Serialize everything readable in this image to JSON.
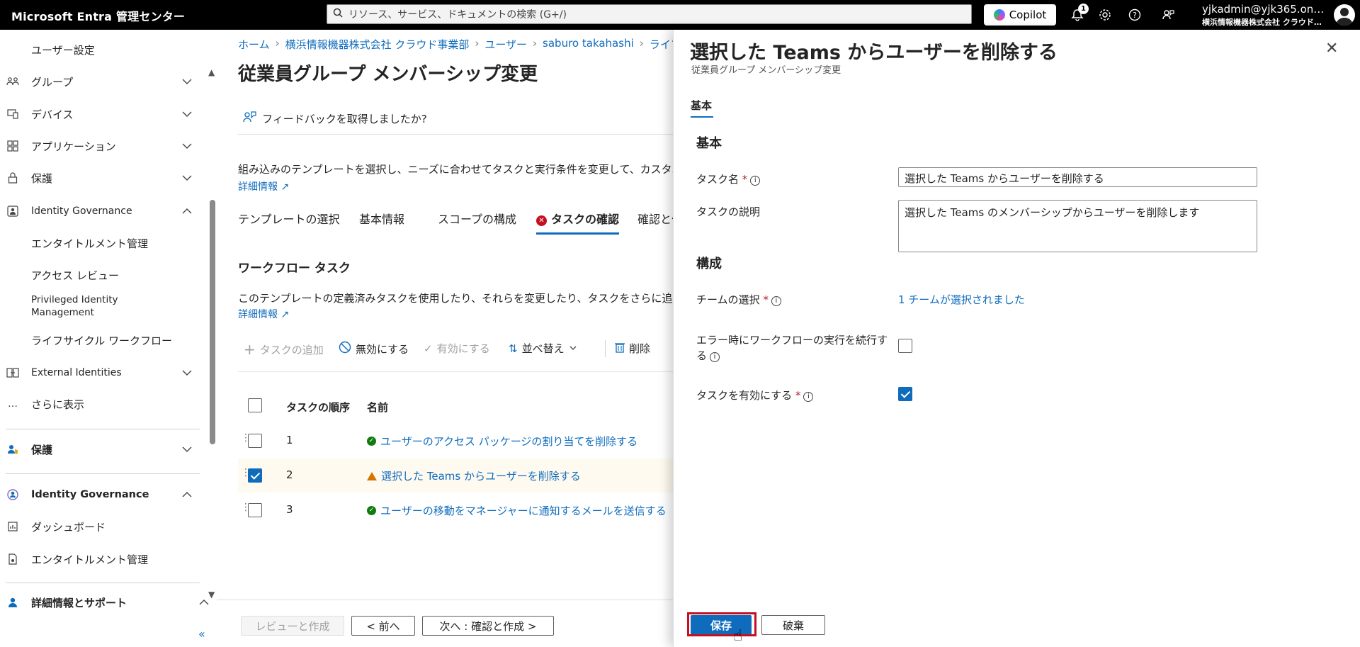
{
  "topbar": {
    "brand": "Microsoft Entra 管理センター",
    "search_placeholder": "リソース、サービス、ドキュメントの検索 (G+/)",
    "copilot_label": "Copilot",
    "notification_count": "1",
    "user_email": "yjkadmin@yjk365.on…",
    "user_org": "横浜情報機器株式会社 クラウド…"
  },
  "sidebar": {
    "items": [
      {
        "label": "ユーザー設定"
      },
      {
        "label": "グループ"
      },
      {
        "label": "デバイス"
      },
      {
        "label": "アプリケーション"
      },
      {
        "label": "保護"
      },
      {
        "label": "Identity Governance"
      },
      {
        "label": "エンタイトルメント管理"
      },
      {
        "label": "アクセス レビュー"
      },
      {
        "label": "Privileged Identity Management"
      },
      {
        "label": "ライフサイクル ワークフロー"
      },
      {
        "label": "External Identities"
      },
      {
        "label": "さらに表示"
      },
      {
        "label": "保護"
      },
      {
        "label": "Identity Governance"
      },
      {
        "label": "ダッシュボード"
      },
      {
        "label": "エンタイトルメント管理"
      },
      {
        "label": "詳細情報とサポート"
      }
    ],
    "more_icon": "…",
    "collapse_icon": "«"
  },
  "main": {
    "breadcrumb": [
      "ホーム",
      "横浜情報機器株式会社 クラウド事業部",
      "ユーザー",
      "saburo takahashi",
      "ライフ"
    ],
    "title": "従業員グループ メンバーシップ変更",
    "title_more": "…",
    "feedback": "フィードバックを取得しましたか?",
    "description": "組み込みのテンプレートを選択し、ニーズに合わせてタスクと実行条件を変更して、カスタム",
    "learn_more": "詳細情報",
    "tabs": [
      {
        "label": "テンプレートの選択"
      },
      {
        "label": "基本情報"
      },
      {
        "label": "スコープの構成"
      },
      {
        "label": "タスクの確認"
      },
      {
        "label": "確認と作"
      }
    ],
    "section_title": "ワークフロー タスク",
    "section_desc": "このテンプレートの定義済みタスクを使用したり、それらを変更したり、タスクをさらに追加",
    "learn_more2": "詳細情報",
    "toolbar": {
      "add": "タスクの追加",
      "disable": "無効にする",
      "enable": "有効にする",
      "sort": "並べ替え",
      "delete": "削除"
    },
    "table": {
      "headers": [
        "タスクの順序",
        "名前"
      ],
      "rows": [
        {
          "order": "1",
          "name": "ユーザーのアクセス パッケージの割り当てを削除する",
          "status": "ok",
          "checked": false
        },
        {
          "order": "2",
          "name": "選択した Teams からユーザーを削除する",
          "status": "warning",
          "checked": true
        },
        {
          "order": "3",
          "name": "ユーザーの移動をマネージャーに通知するメールを送信する",
          "status": "ok",
          "checked": false
        }
      ]
    },
    "footer": {
      "review": "レビューと作成",
      "prev": "< 前へ",
      "next": "次へ : 確認と作成 >"
    }
  },
  "panel": {
    "title": "選択した Teams からユーザーを削除する",
    "subtitle": "従業員グループ メンバーシップ変更",
    "tab": "基本",
    "section_basic": "基本",
    "task_name_label": "タスク名",
    "task_name_value": "選択した Teams からユーザーを削除する",
    "task_desc_label": "タスクの説明",
    "task_desc_value": "選択した Teams のメンバーシップからユーザーを削除します",
    "section_config": "構成",
    "team_select_label": "チームの選択",
    "team_select_value": "1 チームが選択されました",
    "continue_on_error_label_1": "エラー時にワークフローの実行を続行す",
    "continue_on_error_label_2": "る",
    "enable_task_label": "タスクを有効にする",
    "save": "保存",
    "discard": "破棄"
  }
}
